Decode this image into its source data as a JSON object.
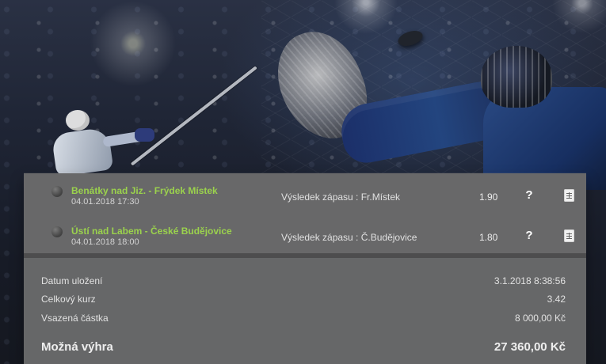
{
  "matches": [
    {
      "teams": "Benátky nad Jiz. - Frýdek Místek",
      "date": "04.01.2018 17:30",
      "market": "Výsledek zápasu : Fr.Místek",
      "odds": "1.90",
      "help_icon": "?",
      "stats_icon": "stats-icon"
    },
    {
      "teams": "Ústí nad Labem - České Budějovice",
      "date": "04.01.2018 18:00",
      "market": "Výsledek zápasu : Č.Budějovice",
      "odds": "1.80",
      "help_icon": "?",
      "stats_icon": "stats-icon"
    }
  ],
  "summary": {
    "saved_label": "Datum uložení",
    "saved_value": "3.1.2018 8:38:56",
    "total_odds_label": "Celkový kurz",
    "total_odds_value": "3.42",
    "stake_label": "Vsazená částka",
    "stake_value": "8 000,00 Kč",
    "possible_win_label": "Možná výhra",
    "possible_win_value": "27 360,00 Kč"
  },
  "colors": {
    "team_text": "#9bd24d",
    "panel_background": "#666768",
    "separator": "#4d4d4e"
  }
}
